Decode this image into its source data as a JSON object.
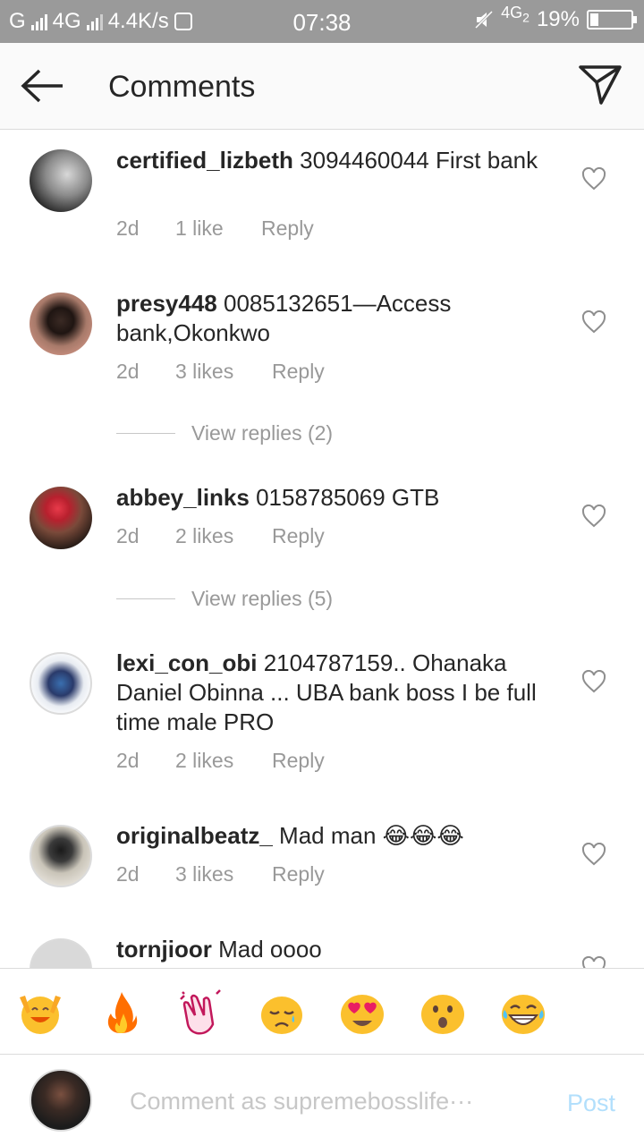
{
  "status_bar": {
    "carrier1": "G",
    "carrier2": "4G",
    "speed": "4.4K/s",
    "time": "07:38",
    "network": "4G",
    "network_sub": "2",
    "battery": "19%",
    "battery_level": 0.19
  },
  "header": {
    "title": "Comments"
  },
  "comments": [
    {
      "username": "certified_lizbeth",
      "text": " 3094460044 First bank",
      "time": "2d",
      "likes": "1 like",
      "reply": "Reply",
      "view_replies": ""
    },
    {
      "username": "presy448",
      "text": " 0085132651—Access bank,Okonkwo",
      "time": "2d",
      "likes": "3 likes",
      "reply": "Reply",
      "view_replies": "View replies (2)"
    },
    {
      "username": "abbey_links",
      "text": " 0158785069 GTB",
      "time": "2d",
      "likes": "2 likes",
      "reply": "Reply",
      "view_replies": "View replies (5)"
    },
    {
      "username": "lexi_con_obi",
      "text": " 2104787159.. Ohanaka Daniel Obinna ... UBA bank boss I be full time male PRO",
      "time": "2d",
      "likes": "2 likes",
      "reply": "Reply",
      "view_replies": ""
    },
    {
      "username": "originalbeatz_",
      "text": " Mad man 😂😂😂",
      "time": "2d",
      "likes": "3 likes",
      "reply": "Reply",
      "view_replies": ""
    },
    {
      "username": "tornjioor",
      "text": " Mad oooo",
      "time": "",
      "likes": "",
      "reply": "",
      "view_replies": ""
    }
  ],
  "emoji_bar": [
    "raising-hands",
    "fire",
    "clapping-hands",
    "crying-face",
    "heart-eyes",
    "surprised-face",
    "laughing-tears"
  ],
  "composer": {
    "placeholder": "Comment as supremebosslife···",
    "post_label": "Post"
  },
  "colors": {
    "status_bar": "#9a9a9a",
    "header_bg": "#fafafa",
    "secondary_text": "#999999",
    "post_disabled": "#b2dffc"
  }
}
